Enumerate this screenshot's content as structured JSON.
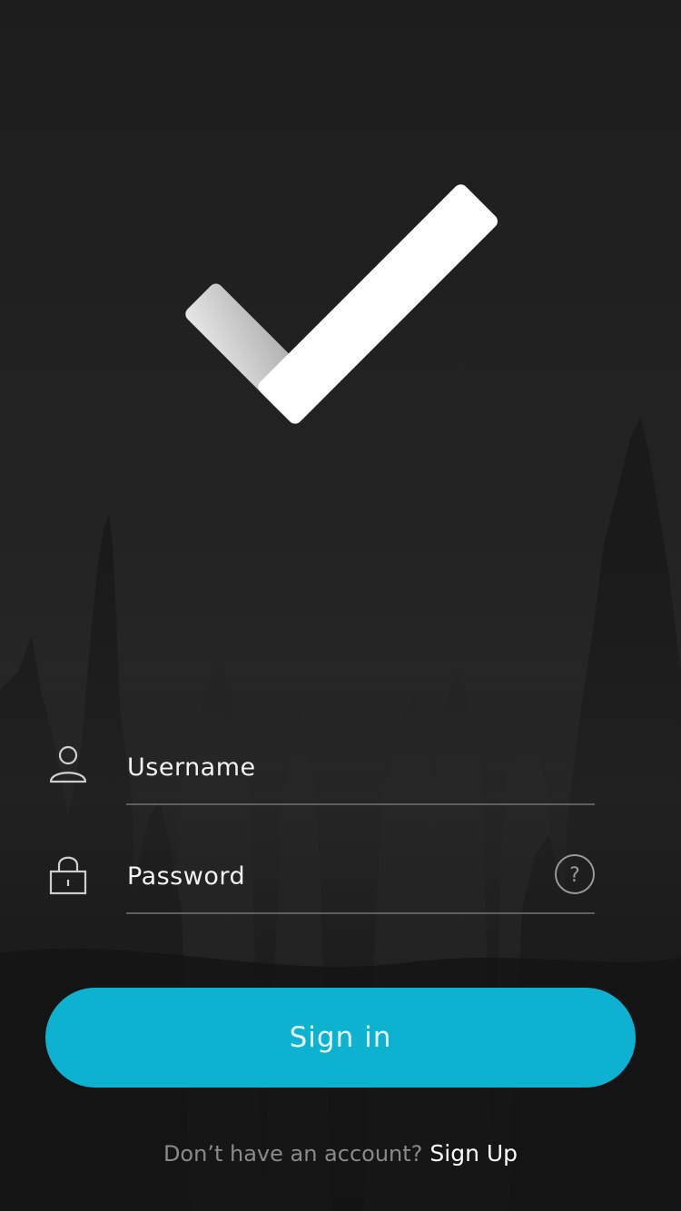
{
  "app": {
    "logo": "checkmark-logo",
    "background": "foggy-forest"
  },
  "form": {
    "username_placeholder": "Username",
    "password_placeholder": "Password",
    "username_icon": "user-icon",
    "password_icon": "lock-icon",
    "help_icon": "question-circle-icon",
    "help_glyph": "?"
  },
  "actions": {
    "signin_label": "Sign in",
    "signup_prompt": "Don’t have an account?",
    "signup_link": "Sign Up"
  },
  "colors": {
    "accent": "#0cb2cf",
    "background": "#1f1f1f",
    "text": "#f2f2f2",
    "muted_text": "#8a8a8a"
  }
}
